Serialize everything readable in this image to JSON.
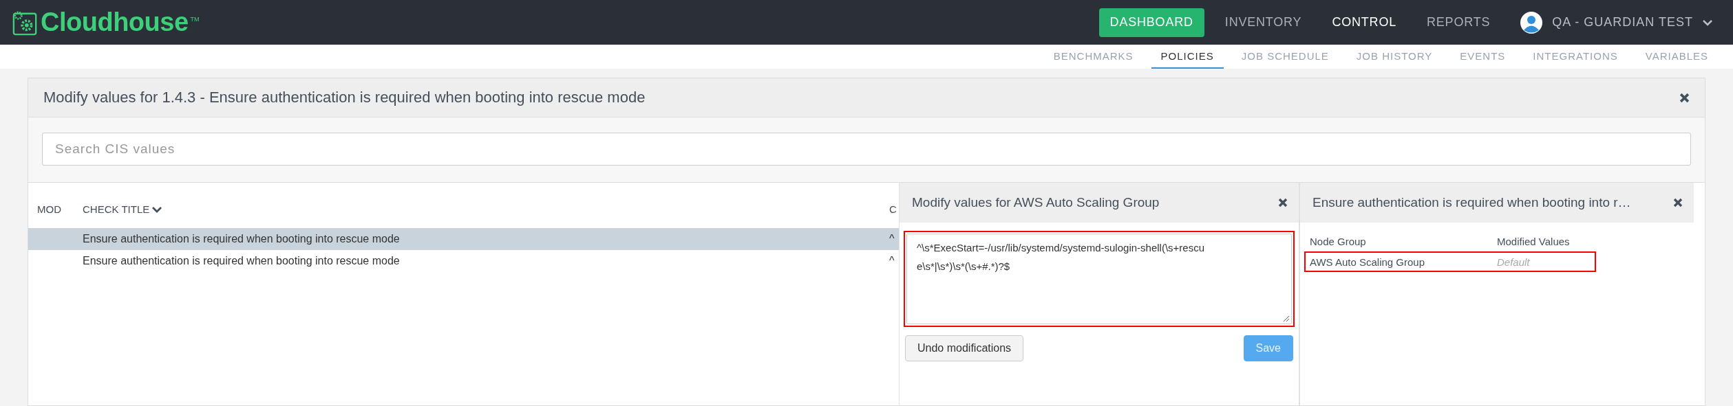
{
  "logo": {
    "name": "Cloudhouse",
    "mark": "TM"
  },
  "nav": [
    {
      "label": "DASHBOARD",
      "kind": "button",
      "selected": false
    },
    {
      "label": "INVENTORY",
      "kind": "link",
      "selected": false
    },
    {
      "label": "CONTROL",
      "kind": "link",
      "selected": true
    },
    {
      "label": "REPORTS",
      "kind": "link",
      "selected": false
    }
  ],
  "user": {
    "name": "QA - GUARDIAN TEST"
  },
  "subnav": [
    {
      "label": "BENCHMARKS",
      "selected": false
    },
    {
      "label": "POLICIES",
      "selected": true
    },
    {
      "label": "JOB SCHEDULE",
      "selected": false
    },
    {
      "label": "JOB HISTORY",
      "selected": false
    },
    {
      "label": "EVENTS",
      "selected": false
    },
    {
      "label": "INTEGRATIONS",
      "selected": false
    },
    {
      "label": "VARIABLES",
      "selected": false
    }
  ],
  "modal": {
    "title": "Modify values for 1.4.3 - Ensure authentication is required when booting into rescue mode",
    "search": {
      "placeholder": "Search CIS values"
    },
    "table": {
      "columns": [
        "MOD",
        "CHECK TITLE",
        "C"
      ],
      "rows": [
        {
          "title": "Ensure authentication is required when booting into rescue mode",
          "column_3": "^",
          "selected": true
        },
        {
          "title": "Ensure authentication is required when booting into rescue mode",
          "column_3": "^",
          "selected": false
        }
      ]
    }
  },
  "edit_panel": {
    "title": "Modify values for AWS Auto Scaling Group",
    "value": "^\\s*ExecStart=-/usr/lib/systemd/systemd-sulogin-shell(\\s+rescue\\s*|\\s*)\\s*(\\s+#.*)?$",
    "highlighted": true,
    "buttons": [
      {
        "label": "Undo modifications",
        "kind": "secondary",
        "disabled": false
      },
      {
        "label": "Save",
        "kind": "primary",
        "disabled": true
      }
    ]
  },
  "detail_panel": {
    "title": "Ensure authentication is required when booting into r…",
    "columns": [
      "Node Group",
      "Modified Values"
    ],
    "rows": [
      {
        "node_group": "AWS Auto Scaling Group",
        "modified_values": "Default",
        "highlighted": true
      }
    ]
  }
}
